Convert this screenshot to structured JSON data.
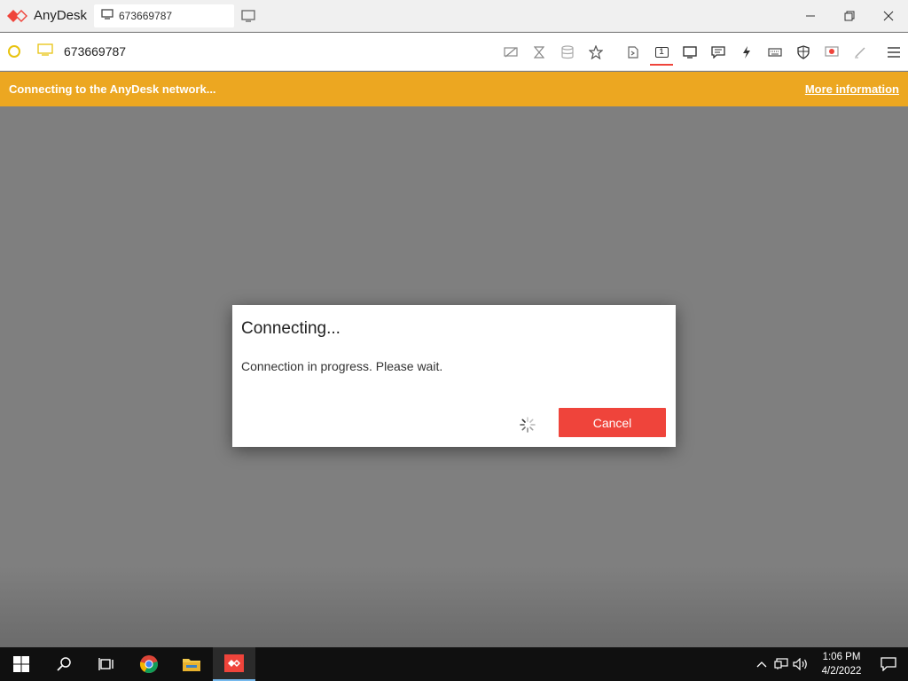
{
  "app": {
    "name": "AnyDesk",
    "tab_address": "673669787",
    "accent": "#ef443b"
  },
  "window_controls": [
    "minimize-icon",
    "restore-icon",
    "close-icon"
  ],
  "addressbar": {
    "address": "673669787",
    "status_color": "#e8c30f",
    "tools": [
      "privacy-icon",
      "hourglass-icon",
      "database-icon",
      "star-icon",
      "file-transfer-icon",
      "monitor-1-icon",
      "display-icon",
      "chat-icon",
      "actions-icon",
      "keyboard-icon",
      "permissions-icon",
      "record-icon",
      "whiteboard-icon",
      "menu-icon"
    ],
    "active_monitor_label": "1"
  },
  "banner": {
    "message": "Connecting to the AnyDesk network...",
    "link": "More information",
    "color": "#eca721"
  },
  "dialog": {
    "title": "Connecting...",
    "message": "Connection in progress. Please wait.",
    "cancel_label": "Cancel"
  },
  "taskbar": {
    "items": [
      "windows-start-icon",
      "search-icon",
      "task-view-icon",
      "chrome-icon",
      "file-explorer-icon",
      "anydesk-icon"
    ],
    "time": "1:06 PM",
    "date": "4/2/2022"
  }
}
